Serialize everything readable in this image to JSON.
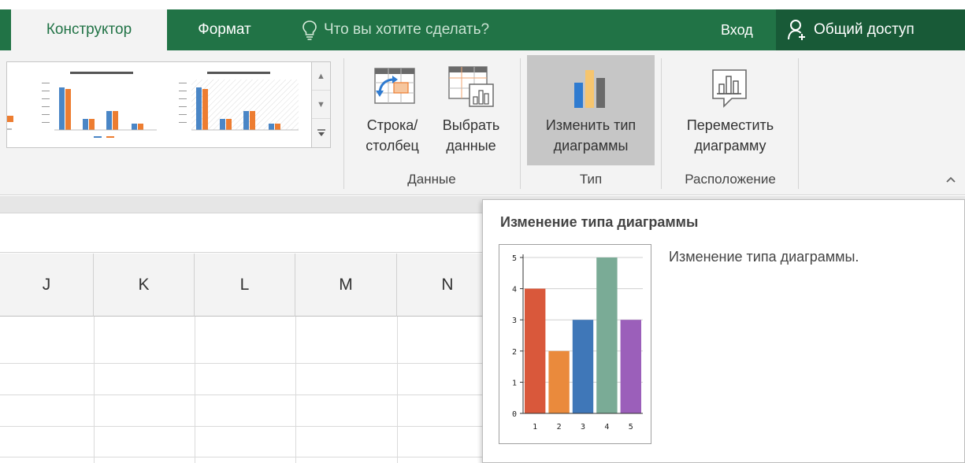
{
  "tabs": {
    "constructor": "Конструктор",
    "format": "Формат"
  },
  "tell_me": {
    "placeholder": "Что вы хотите сделать?"
  },
  "sign_in": "Вход",
  "share": "Общий доступ",
  "ribbon": {
    "switch_row_col": {
      "line1": "Строка/",
      "line2": "столбец"
    },
    "select_data": {
      "line1": "Выбрать",
      "line2": "данные"
    },
    "change_chart_type": {
      "line1": "Изменить тип",
      "line2": "диаграммы"
    },
    "move_chart": {
      "line1": "Переместить",
      "line2": "диаграмму"
    },
    "groups": {
      "data": "Данные",
      "type": "Тип",
      "location": "Расположение"
    }
  },
  "columns": [
    "J",
    "K",
    "L",
    "M",
    "N"
  ],
  "tooltip": {
    "title": "Изменение типа диаграммы",
    "description": "Изменение типа диаграммы."
  },
  "colors": {
    "excel_green": "#217346",
    "share_green": "#185a37",
    "highlight": "#c6c6c6"
  },
  "chart_data": {
    "type": "bar",
    "categories": [
      "1",
      "2",
      "3",
      "4",
      "5"
    ],
    "values": [
      4,
      2,
      3,
      5,
      3
    ],
    "colors": [
      "#d9583b",
      "#ea8a3c",
      "#3f77b8",
      "#7aab96",
      "#9b5fba"
    ],
    "yticks": [
      "0",
      "1",
      "2",
      "3",
      "4",
      "5"
    ],
    "ylim": [
      0,
      5
    ],
    "grid": true
  }
}
